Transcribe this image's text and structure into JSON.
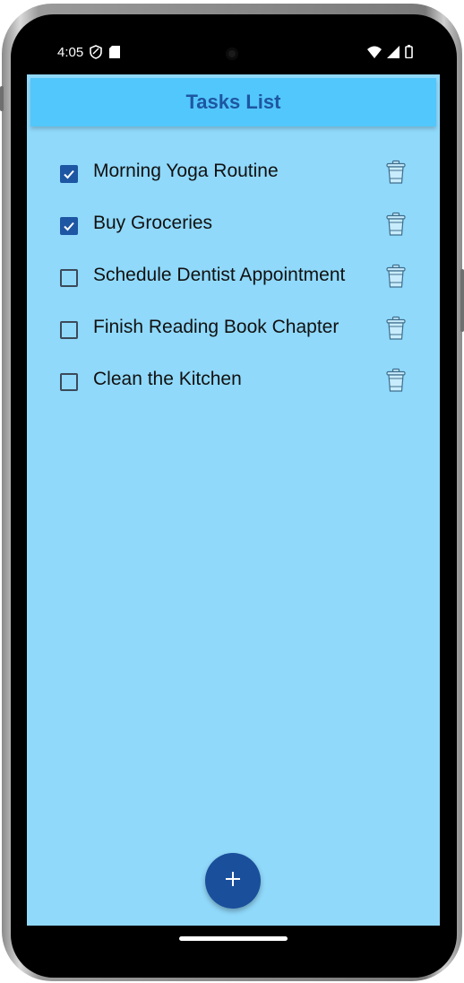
{
  "status_bar": {
    "time": "4:05",
    "left_icons": [
      "shield-icon",
      "sd-card-icon"
    ],
    "right_icons": [
      "wifi-icon",
      "signal-icon",
      "battery-icon"
    ]
  },
  "app_bar": {
    "title": "Tasks List"
  },
  "tasks": [
    {
      "label": "Morning Yoga Routine",
      "checked": true
    },
    {
      "label": "Buy Groceries",
      "checked": true
    },
    {
      "label": "Schedule Dentist Appointment",
      "checked": false
    },
    {
      "label": "Finish Reading Book Chapter",
      "checked": false
    },
    {
      "label": "Clean the Kitchen",
      "checked": false
    }
  ],
  "fab": {
    "icon": "plus-icon"
  },
  "colors": {
    "screen_bg": "#90d9fb",
    "app_bar_bg": "#52c7fb",
    "title_text": "#1d56a3",
    "checkbox_checked": "#1d56a3",
    "fab_bg": "#1a4f9c"
  }
}
